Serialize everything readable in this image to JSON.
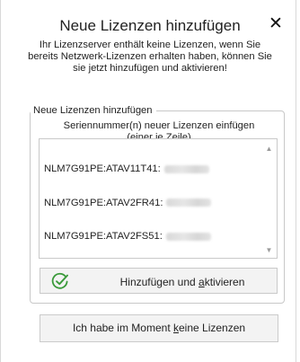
{
  "dialog": {
    "title": "Neue Lizenzen hinzufügen",
    "close_glyph": "✕",
    "intro_lines": [
      "Ihr Lizenzserver enthält keine Lizenzen, wenn Sie",
      "bereits Netzwerk-Lizenzen erhalten haben, können Sie",
      "sie jetzt hinzufügen und aktivieren!"
    ]
  },
  "group": {
    "legend": "Neue Lizenzen hinzufügen",
    "instruction_line1": "Seriennummer(n) neuer Lizenzen einfügen",
    "instruction_line2": "(einer je Zeile)",
    "serial_prefixes": [
      "NLM7G91PE:ATAV11T41:",
      "NLM7G91PE:ATAV2FR41:",
      "NLM7G91PE:ATAV2FS51:"
    ]
  },
  "buttons": {
    "add_before_hotkey": "Hinzufügen und ",
    "add_hotkey": "a",
    "add_after_hotkey": "ktivieren",
    "no_lic_before_hotkey": "Ich habe im Moment ",
    "no_lic_hotkey": "k",
    "no_lic_after_hotkey": "eine Lizenzen"
  },
  "icons": {
    "check": "check-circle-icon",
    "scroll_up": "scroll-up-arrow-icon",
    "scroll_down": "scroll-down-arrow-icon"
  },
  "colors": {
    "check_green": "#3a9a3a",
    "button_bg": "#f3f3f3",
    "border": "#c9c9c9"
  }
}
